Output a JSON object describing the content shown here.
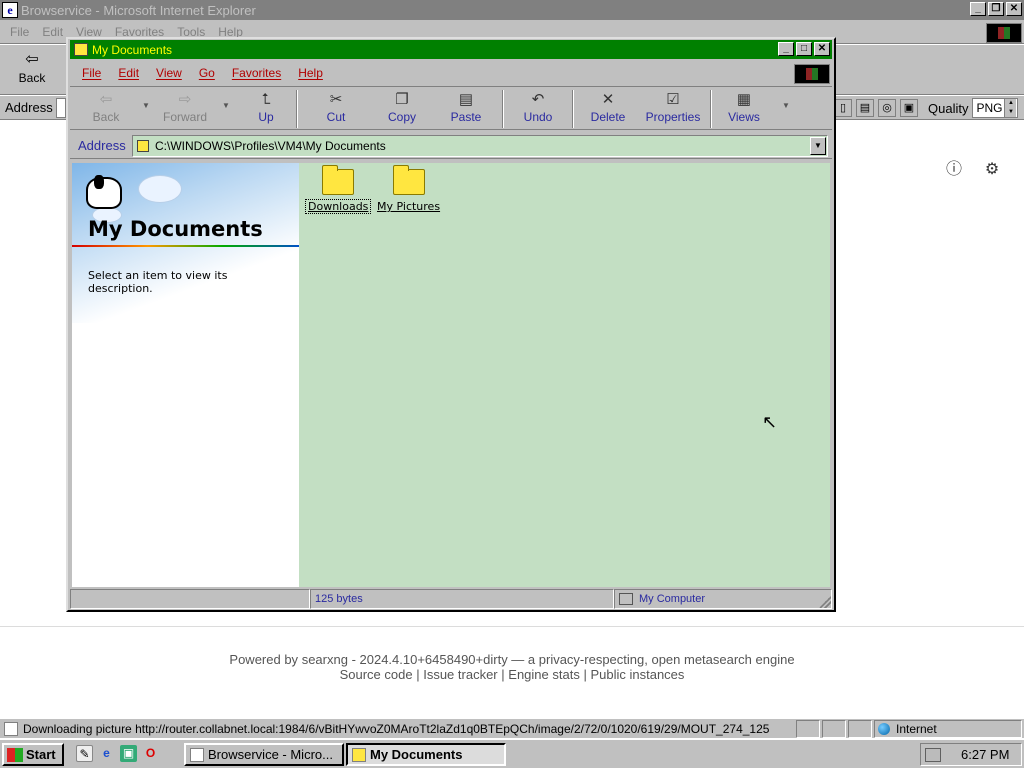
{
  "ie_window": {
    "title": "Browservice - Microsoft Internet Explorer",
    "menu": [
      "File",
      "Edit",
      "View",
      "Favorites",
      "Tools",
      "Help"
    ],
    "toolbar": {
      "back_label": "Back"
    },
    "address_label": "Address",
    "quality_label": "Quality",
    "quality_value": "PNG"
  },
  "page": {
    "footer_line1_prefix": "Powered by",
    "footer_link_searxng": "searxng",
    "footer_line1_suffix": "- 2024.4.10+6458490+dirty — a privacy-respecting, open metasearch engine",
    "footer_links": [
      "Source code",
      "Issue tracker",
      "Engine stats",
      "Public instances"
    ],
    "footer_separator": "|"
  },
  "ie_status": {
    "text": "Downloading picture http://router.collabnet.local:1984/6/vBitHYwvoZ0MAroTt2laZd1q0BTEpQCh/image/2/72/0/1020/619/29/MOUT_274_125",
    "zone": "Internet"
  },
  "explorer": {
    "title": "My Documents",
    "menu": [
      "File",
      "Edit",
      "View",
      "Go",
      "Favorites",
      "Help"
    ],
    "toolbar": {
      "back": "Back",
      "forward": "Forward",
      "up": "Up",
      "cut": "Cut",
      "copy": "Copy",
      "paste": "Paste",
      "undo": "Undo",
      "delete": "Delete",
      "properties": "Properties",
      "views": "Views"
    },
    "address_label": "Address",
    "address_value": "C:\\WINDOWS\\Profiles\\VM4\\My Documents",
    "left_panel": {
      "title": "My Documents",
      "description": "Select an item to view its description."
    },
    "items": [
      {
        "name": "Downloads"
      },
      {
        "name": "My Pictures"
      }
    ],
    "status": {
      "size": "125 bytes",
      "location": "My Computer"
    }
  },
  "taskbar": {
    "start_label": "Start",
    "tasks": [
      "Browservice - Micro...",
      "My Documents"
    ],
    "clock": "6:27 PM"
  },
  "colors": {
    "explorer_title_bg": "#008000",
    "explorer_title_fg": "#ffff00",
    "folder_view_bg": "#c3dfc3",
    "menu_text": "#b00000"
  }
}
